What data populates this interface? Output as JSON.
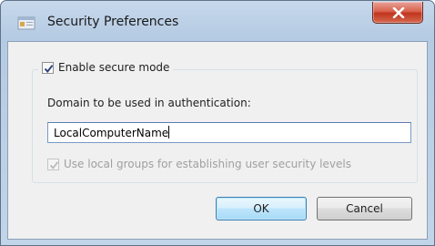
{
  "window": {
    "title": "Security Preferences",
    "icon": "app-window-icon",
    "close_icon": "close-icon"
  },
  "group": {
    "enable_secure_mode_label": "Enable secure mode",
    "enable_secure_mode_checked": true
  },
  "domain": {
    "label": "Domain to be used in authentication:",
    "value": "LocalComputerName"
  },
  "use_local_groups": {
    "label": "Use local groups for establishing user security levels",
    "checked": true,
    "enabled": false
  },
  "buttons": {
    "ok_label": "OK",
    "cancel_label": "Cancel"
  },
  "colors": {
    "title_bar": "#b5cbe3",
    "close_button": "#c0351d",
    "client_bg": "#f0f0f0",
    "default_button": "#bee6fd"
  }
}
